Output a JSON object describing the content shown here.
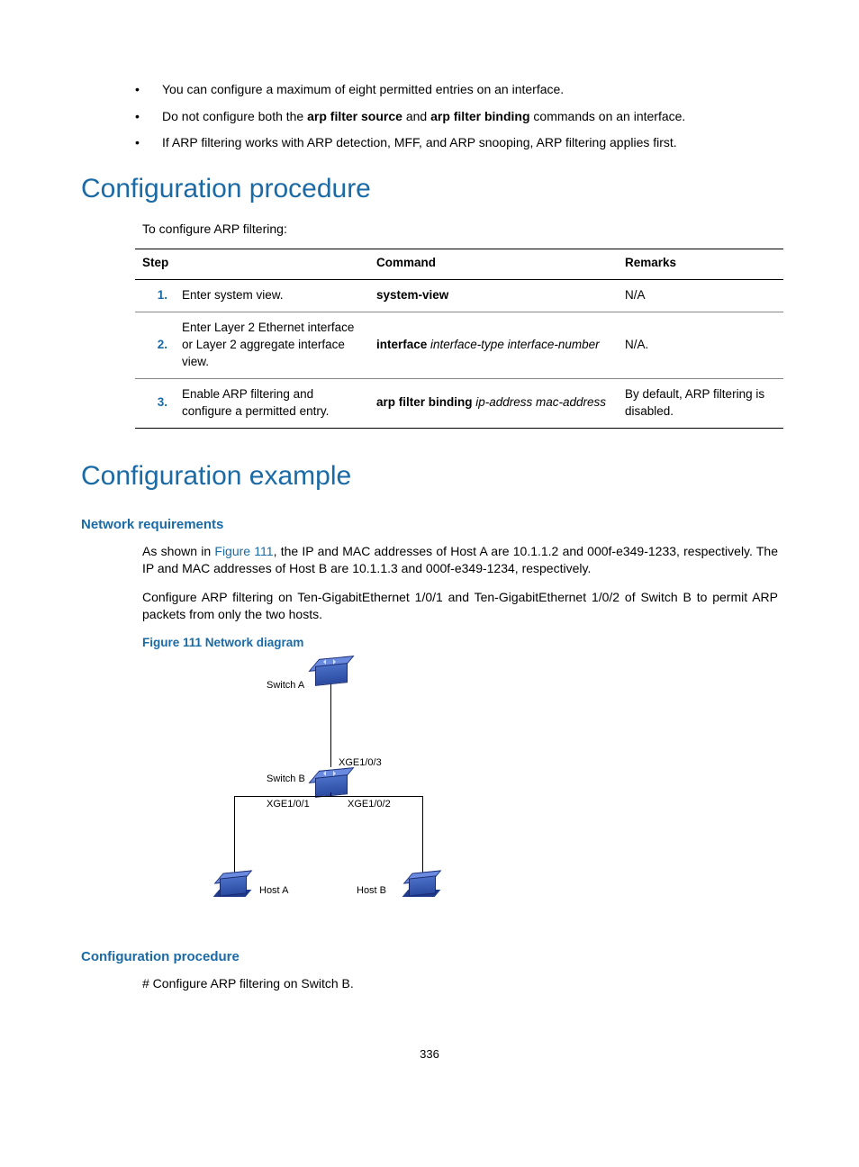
{
  "bullets": [
    "You can configure a maximum of eight permitted entries on an interface.",
    {
      "pre": "Do not configure both the ",
      "b1": "arp filter source",
      "mid": " and ",
      "b2": "arp filter binding",
      "post": " commands on an interface."
    },
    "If ARP filtering works with ARP detection, MFF, and ARP snooping, ARP filtering applies first."
  ],
  "heading_proc": "Configuration procedure",
  "intro_proc": "To configure ARP filtering:",
  "table": {
    "head": {
      "step": "Step",
      "command": "Command",
      "remarks": "Remarks"
    },
    "rows": [
      {
        "n": "1.",
        "step": "Enter system view.",
        "cmd_b": "system-view",
        "cmd_i": "",
        "remarks": "N/A"
      },
      {
        "n": "2.",
        "step": "Enter Layer 2 Ethernet interface or Layer 2 aggregate interface view.",
        "cmd_b": "interface",
        "cmd_i": " interface-type interface-number",
        "remarks": "N/A."
      },
      {
        "n": "3.",
        "step": "Enable ARP filtering and configure a permitted entry.",
        "cmd_b": "arp filter binding",
        "cmd_i": " ip-address mac-address",
        "remarks": "By default, ARP filtering is disabled."
      }
    ]
  },
  "heading_ex": "Configuration example",
  "sub_netreq": "Network requirements",
  "para1_pre": "As shown in ",
  "para1_link": "Figure 111",
  "para1_post": ", the IP and MAC addresses of Host A are 10.1.1.2 and 000f-e349-1233, respectively. The IP and MAC addresses of Host B are 10.1.1.3 and 000f-e349-1234, respectively.",
  "para2": "Configure ARP filtering on Ten-GigabitEthernet 1/0/1 and Ten-GigabitEthernet 1/0/2 of Switch B to permit ARP packets from only the two hosts.",
  "figcap": "Figure 111 Network diagram",
  "diagram": {
    "switchA": "Switch A",
    "switchB": "Switch B",
    "xge103": "XGE1/0/3",
    "xge101": "XGE1/0/1",
    "xge102": "XGE1/0/2",
    "hostA": "Host A",
    "hostB": "Host B"
  },
  "sub_confproc": "Configuration procedure",
  "confproc_line": "# Configure ARP filtering on Switch B.",
  "pagenum": "336"
}
